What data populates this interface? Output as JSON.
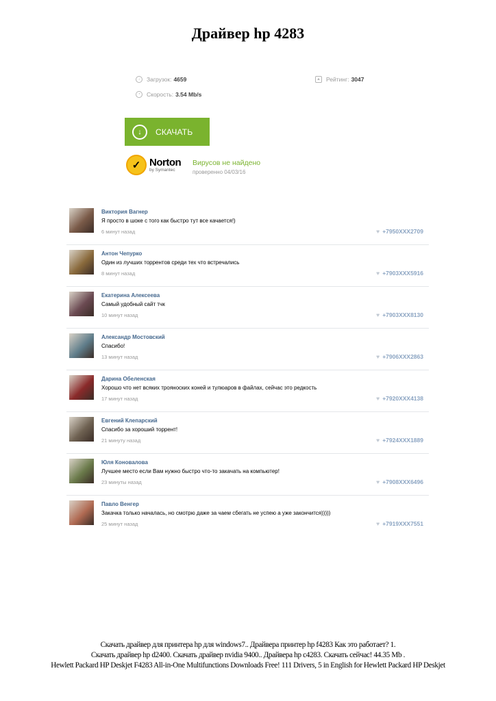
{
  "title": "Драйвер hp 4283",
  "stats": {
    "downloads_label": "Загрузок:",
    "downloads_value": "4659",
    "speed_label": "Скорость:",
    "speed_value": "3.54 Mb/s",
    "rating_label": "Рейтинг:",
    "rating_value": "3047"
  },
  "download_button": "СКАЧАТЬ",
  "norton": {
    "brand": "Norton",
    "sub": "by Symantec",
    "status": "Вирусов не найдено",
    "checked": "проверенно 04/03/16"
  },
  "comments": [
    {
      "name": "Виктория Вагнер",
      "text": "Я просто в шоке с того как быстро тут все качается!)",
      "time": "6 минут назад",
      "phone": "+7950XXX2709",
      "avatar_color": "#7a5a48"
    },
    {
      "name": "Антон Чепурко",
      "text": "Один из лучших торрентов среди тех что встречались",
      "time": "8 минут назад",
      "phone": "+7903XXX5916",
      "avatar_color": "#8a6a3c"
    },
    {
      "name": "Екатерина Алексеева",
      "text": "Самый удобный сайт тчк",
      "time": "10 минут назад",
      "phone": "+7903XXX8130",
      "avatar_color": "#6b4a52"
    },
    {
      "name": "Александр Мостовский",
      "text": "Спасибо!",
      "time": "13 минут назад",
      "phone": "+7906XXX2863",
      "avatar_color": "#5f7d8a"
    },
    {
      "name": "Дарина Обеленская",
      "text": "Хорошо что нет всяких трояноских коней и тулюаров в файлах, сейчас это редкость",
      "time": "17 минут назад",
      "phone": "+7920XXX4138",
      "avatar_color": "#8a2a2a"
    },
    {
      "name": "Евгений Клепарский",
      "text": "Спасибо за хороший торрент!",
      "time": "21 минуту назад",
      "phone": "+7924XXX1889",
      "avatar_color": "#6f6252"
    },
    {
      "name": "Юля Коновалова",
      "text": "Лучшее место если Вам нужно быстро что-то закачать на компьютер!",
      "time": "23 минуты назад",
      "phone": "+7908XXX6496",
      "avatar_color": "#6a7a4a"
    },
    {
      "name": "Павло Венгер",
      "text": "Закачка только началась, но смотрю даже за чаем сбегать не успею а уже закончится)))))",
      "time": "25 минут назад",
      "phone": "+7919XXX7551",
      "avatar_color": "#b06a52"
    }
  ],
  "footer": [
    "Скачать драйвер для принтера hp для windows7.. Драйвера принтер hp f4283 Как это работает? 1.",
    "Скачать драйвер hp d2400. Скачать драйвер nvidia 9400.. Драйвера hp c4283. Скачать сейчас! 44.35 Mb .",
    "Hewlett Packard HP Deskjet F4283 All-in-One Multifunctions Downloads Free! 111 Drivers, 5 in English for Hewlett Packard HP Deskjet"
  ]
}
